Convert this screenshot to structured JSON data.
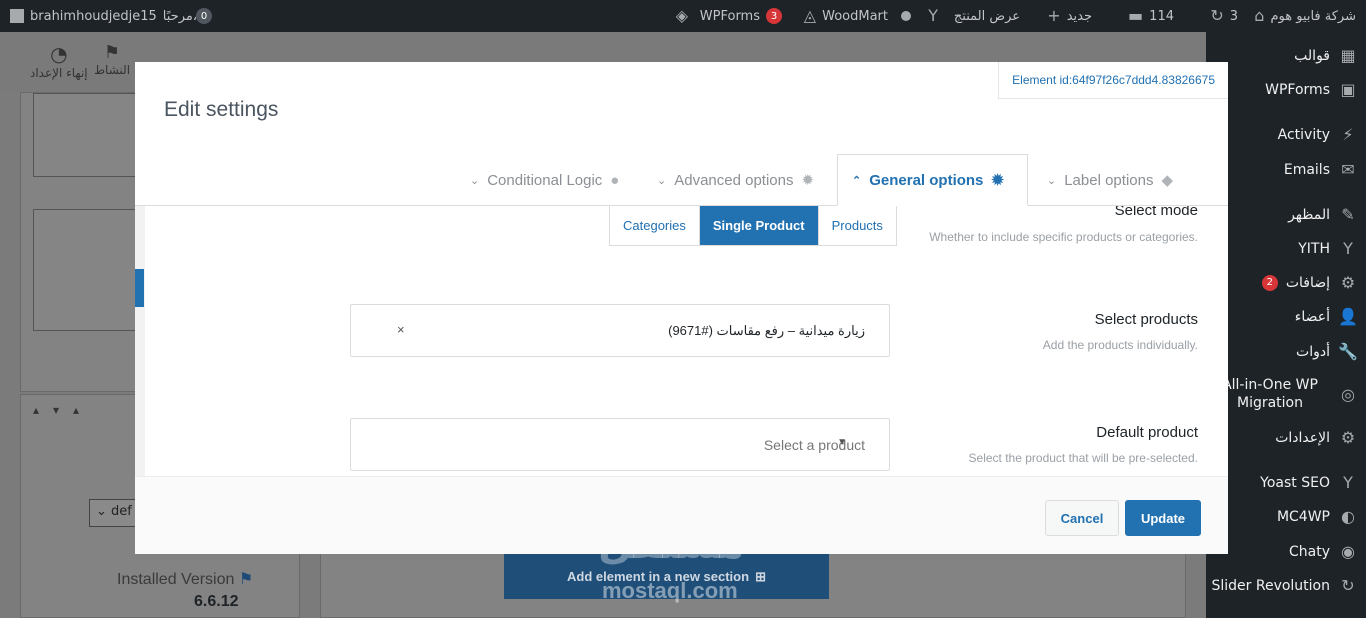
{
  "adminbar": {
    "site_name": "شركة فابيو هوم",
    "updates_count": "3",
    "comments_count": "114",
    "new_label": "جديد",
    "view_product": "عرض المنتج",
    "woodmart": "WoodMart",
    "wpforms": "WPForms",
    "wpforms_count": "3",
    "greeting": "مرحبًا،",
    "username": "brahimhoudjedje15",
    "notif_count": "0"
  },
  "sidebar": {
    "items": [
      {
        "label": "قوالب",
        "icon": "template-icon"
      },
      {
        "label": "WPForms",
        "icon": "wpforms-icon"
      },
      {
        "label": "Activity",
        "icon": "activity-icon"
      },
      {
        "label": "Emails",
        "icon": "mail-icon"
      },
      {
        "label": "المظهر",
        "icon": "brush-icon"
      },
      {
        "label": "YITH",
        "icon": "yith-icon"
      },
      {
        "label": "إضافات",
        "icon": "plugin-icon",
        "badge": "2"
      },
      {
        "label": "أعضاء",
        "icon": "user-icon"
      },
      {
        "label": "أدوات",
        "icon": "wrench-icon"
      },
      {
        "label": "All-in-One WP Migration",
        "icon": "migration-icon"
      },
      {
        "label": "الإعدادات",
        "icon": "settings-icon"
      },
      {
        "label": "Yoast SEO",
        "icon": "yoast-icon"
      },
      {
        "label": "MC4WP",
        "icon": "mc4wp-icon"
      },
      {
        "label": "Chaty",
        "icon": "chaty-icon"
      },
      {
        "label": "Slider Revolution",
        "icon": "revolution-icon"
      }
    ]
  },
  "background": {
    "finish_setup": "إنهاء الإعداد",
    "activity": "النشاط",
    "installed_version_label": "Installed Version",
    "installed_version": "6.6.12",
    "select_value": "def",
    "add_section": "Add element in a new section"
  },
  "modal": {
    "title": "Edit settings",
    "element_id": "Element id:64f97f26c7ddd4.83826675",
    "tabs": {
      "label_options": "Label options",
      "general_options": "General options",
      "advanced_options": "Advanced options",
      "conditional_logic": "Conditional Logic"
    },
    "select_mode": {
      "label": "Select mode",
      "description": "Whether to include specific products or categories.",
      "options": [
        "Categories",
        "Single Product",
        "Products"
      ],
      "selected": "Single Product"
    },
    "select_products": {
      "label": "Select products",
      "description": "Add the products individually.",
      "selected_item": "زيارة ميدانية – رفع مقاسات (#9671)",
      "remove_symbol": "×"
    },
    "default_product": {
      "label": "Default product",
      "description": "Select the product that will be pre-selected.",
      "placeholder": "Select a product"
    },
    "buttons": {
      "cancel": "Cancel",
      "update": "Update"
    }
  },
  "watermark": {
    "arabic": "مستقل",
    "latin": "mostaql.com"
  },
  "colors": {
    "accent": "#2271b1",
    "adminbar_bg": "#1d2327",
    "badge_red": "#d63638"
  }
}
